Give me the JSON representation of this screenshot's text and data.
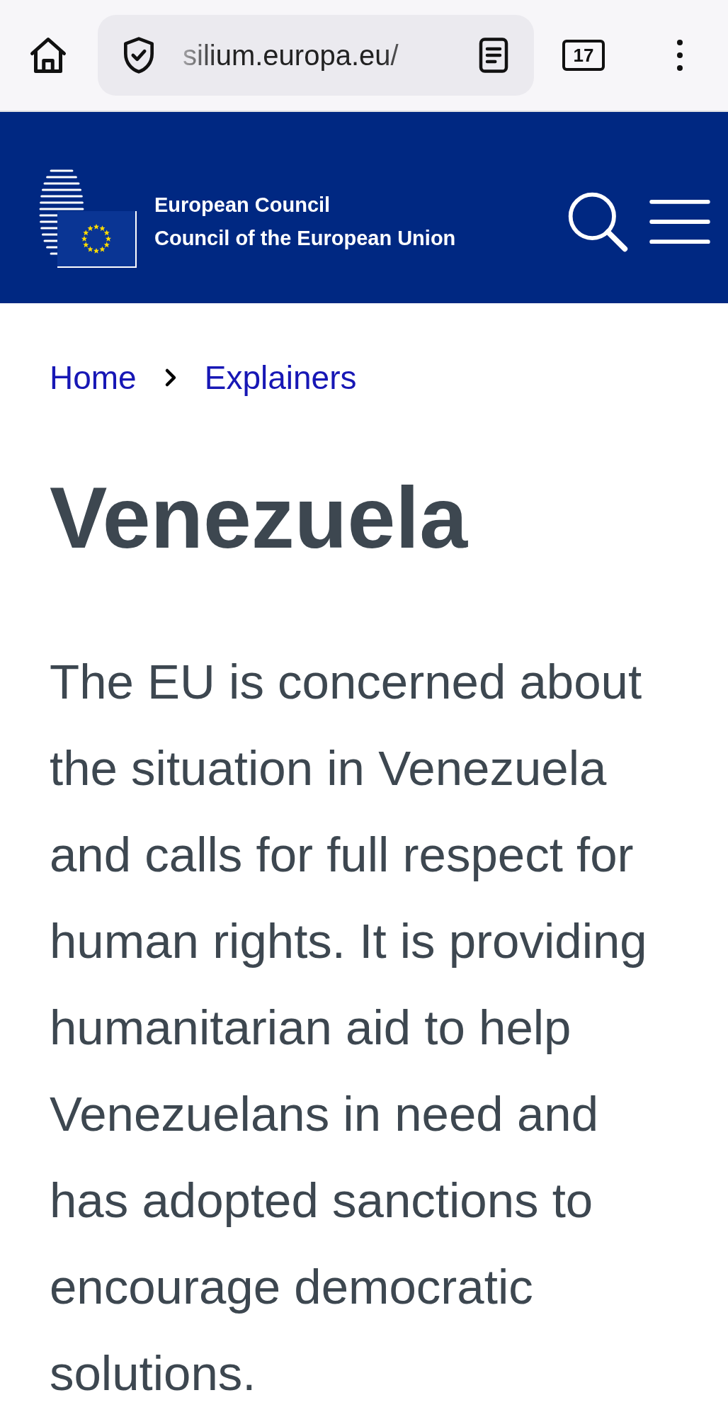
{
  "browser": {
    "url": "silium.europa.eu/",
    "tab_count": "17"
  },
  "header": {
    "org_names": [
      "European Council",
      "Council of the European Union"
    ]
  },
  "breadcrumb": [
    "Home",
    "Explainers"
  ],
  "title": "Venezuela",
  "intro": "The EU is concerned about the situation in Venezuela and calls for full respect for human rights. It is providing humanitarian aid to help Venezuelans in need and has adopted sanctions to encourage democratic solutions."
}
